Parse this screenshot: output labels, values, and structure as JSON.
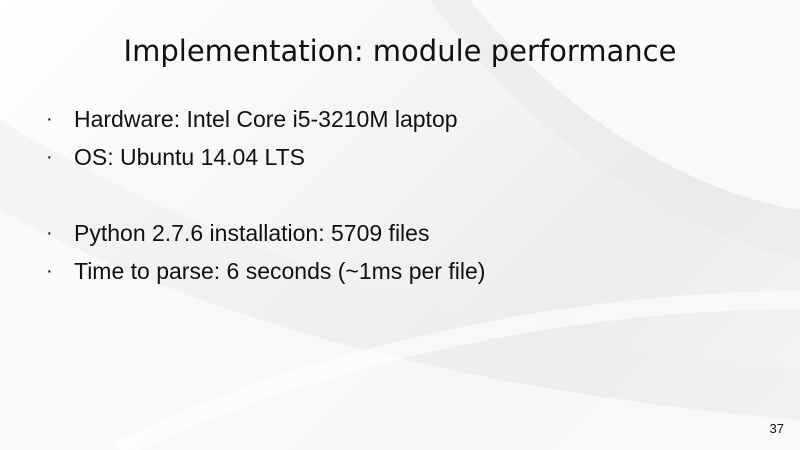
{
  "slide": {
    "title": "Implementation: module performance",
    "bullet_glyph": "·",
    "bullets": [
      "Hardware: Intel Core i5-3210M laptop",
      "OS: Ubuntu 14.04 LTS",
      "Python 2.7.6 installation: 5709 files",
      "Time to parse: 6 seconds (~1ms per file)"
    ],
    "page_number": "37"
  }
}
